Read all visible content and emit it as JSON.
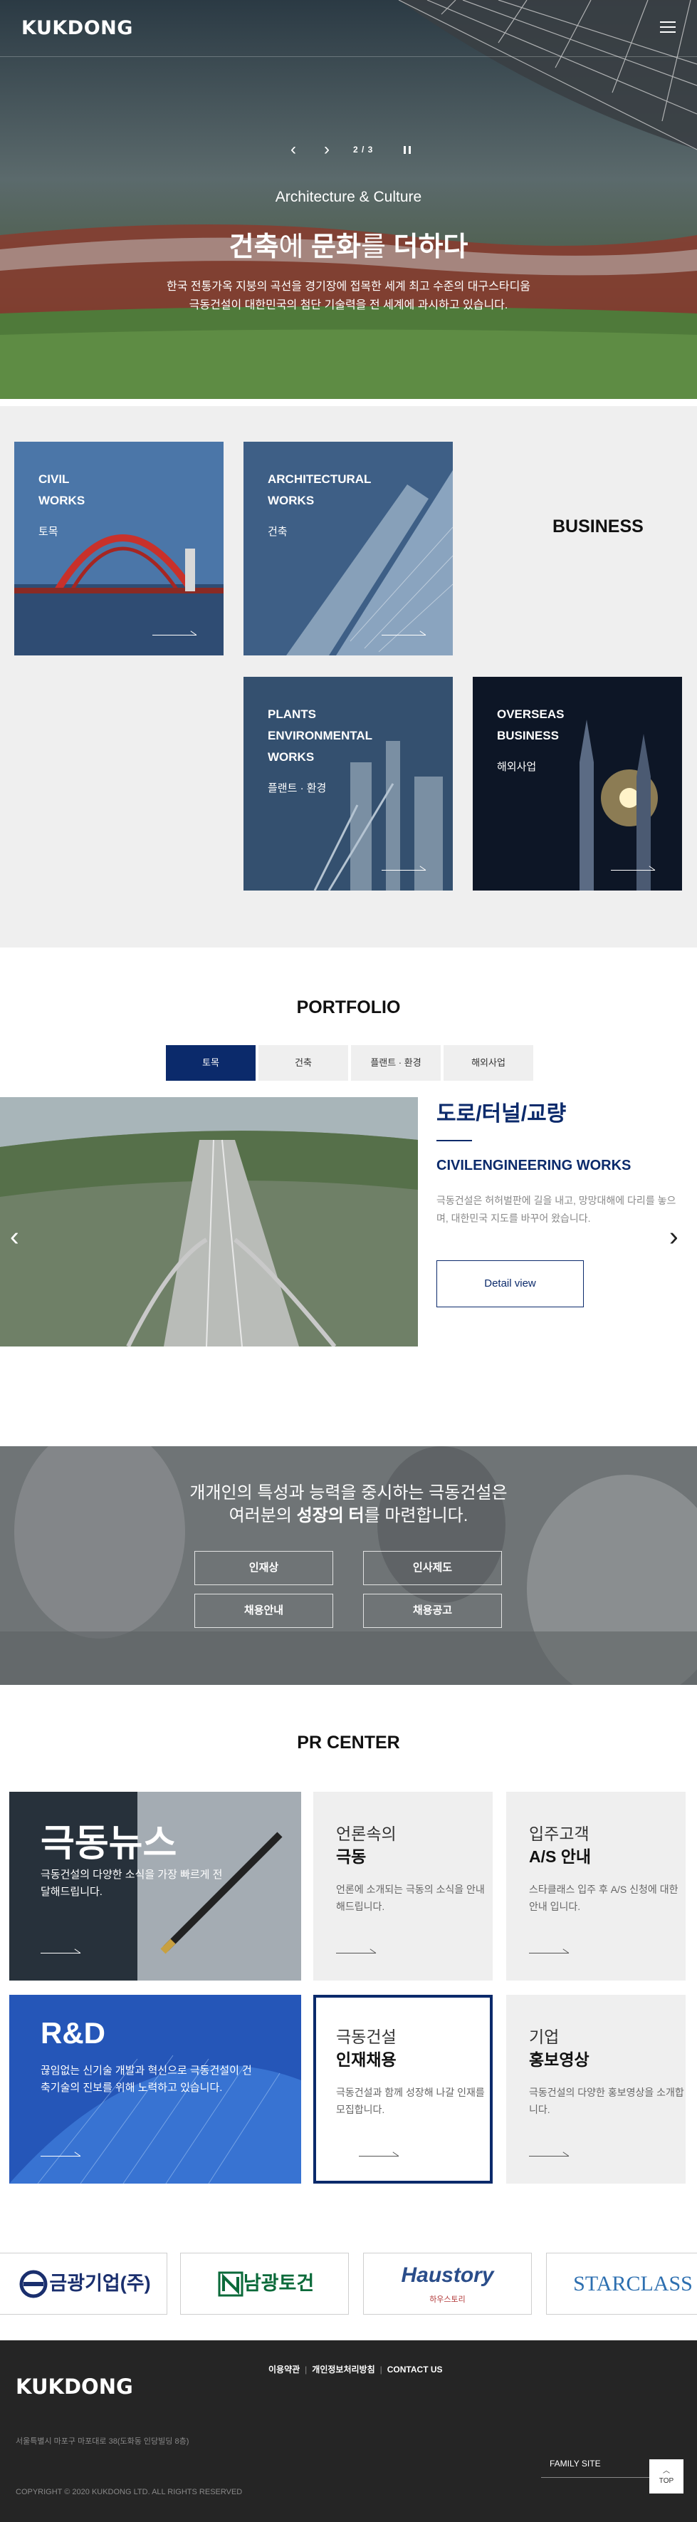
{
  "header": {
    "logo": "KUKDONG",
    "menu_icon": "hamburger-menu-icon"
  },
  "hero": {
    "prev_arrow": "‹",
    "next_arrow": "›",
    "counter": "2 / 3",
    "subtitle": "Architecture & Culture",
    "title_part1": "건축",
    "title_part2": "에 ",
    "title_part3": "문화",
    "title_part4": "를 ",
    "title_part5": "더하다",
    "desc_line1": "한국 전통가옥 지붕의 곡선을 경기장에 접목한 세계 최고 수준의 대구스타디움",
    "desc_line2": "극동건설이 대한민국의 첨단 기술력을 전 세계에 과시하고 있습니다."
  },
  "business": {
    "heading": "BUSINESS",
    "cards": [
      {
        "title": [
          "CIVIL",
          "WORKS"
        ],
        "sub": "토목"
      },
      {
        "title": [
          "ARCHITECTURAL",
          "WORKS"
        ],
        "sub": "건축"
      },
      {
        "title": [
          "PLANTS",
          "ENVIRONMENTAL",
          "WORKS"
        ],
        "sub": "플랜트 · 환경"
      },
      {
        "title": [
          "OVERSEAS",
          "BUSINESS"
        ],
        "sub": "해외사업"
      }
    ]
  },
  "portfolio": {
    "heading": "PORTFOLIO",
    "tabs": [
      "토목",
      "건축",
      "플랜트 · 환경",
      "해외사업"
    ],
    "active_tab": 0,
    "item_title": "도로/터널/교량",
    "item_subtitle": "CIVILENGINEERING WORKS",
    "item_desc": "극동건설은 허허벌판에 길을 내고, 망망대해에 다리를 놓으며, 대한민국 지도를 바꾸어 왔습니다.",
    "detail_button": "Detail view",
    "prev_arrow": "‹",
    "next_arrow": "›"
  },
  "recruit": {
    "line1": "개개인의 특성과 능력을 중시하는 극동건설은",
    "line2_a": "여러분의 ",
    "line2_b": "성장의 터",
    "line2_c": "를 마련합니다.",
    "buttons": [
      "인재상",
      "인사제도",
      "채용안내",
      "채용공고"
    ]
  },
  "pr_center": {
    "heading": "PR CENTER",
    "news": {
      "title": "극동뉴스",
      "desc": "극동건설의 다양한 소식을 가장 빠르게 전달해드립니다."
    },
    "media": {
      "small": "언론속의",
      "big": "극동",
      "desc": "언론에 소개되는 극동의 소식을 안내해드립니다."
    },
    "customer": {
      "small": "입주고객",
      "big": "A/S 안내",
      "desc": "스타클래스 입주 후 A/S 신청에 대한 안내 입니다."
    },
    "rnd": {
      "title": "R&D",
      "desc": "끊임없는 신기술 개발과 혁신으로 극동건설이 건축기술의 진보를 위해 노력하고 있습니다."
    },
    "careers": {
      "small": "극동건설",
      "big": "인재채용",
      "desc": "극동건설과 함께 성장해 나갈 인재를 모집합니다."
    },
    "promo": {
      "small": "기업",
      "big": "홍보영상",
      "desc": "극동건설의 다양한 홍보영상을 소개합니다."
    }
  },
  "partners": [
    {
      "name": "금광기업(주)",
      "color": "#1a2f6e"
    },
    {
      "name": "남광토건",
      "color": "#0b6a3a"
    },
    {
      "name": "Haustory",
      "sub": "하우스토리",
      "color": "#2a4d8a"
    },
    {
      "name": "STARCLASS",
      "color": "#2d6fb0"
    }
  ],
  "footer": {
    "links": [
      "이용약관",
      "개인정보처리방침",
      "CONTACT US"
    ],
    "logo": "KUKDONG",
    "address": "서울특별시 마포구 마포대로 38(도화동 인당빌딩 8층)",
    "copyright": "COPYRIGHT © 2020 KUKDONG LTD. ALL RIGHTS RESERVED",
    "family_site": "FAMILY SITE",
    "top_label": "TOP"
  },
  "colors": {
    "brand_navy": "#0b2a6b",
    "light_gray": "#efefef",
    "footer_bg": "#252525"
  }
}
